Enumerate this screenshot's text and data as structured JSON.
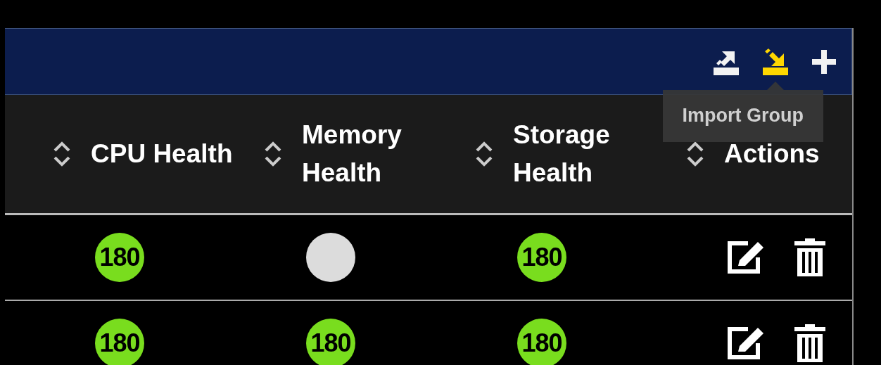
{
  "toolbar": {
    "actions": [
      {
        "kind": "export",
        "selected": false
      },
      {
        "kind": "import",
        "selected": true,
        "tooltip": "Import Group"
      },
      {
        "kind": "add",
        "selected": false
      }
    ]
  },
  "table": {
    "columns": [
      {
        "sortable": true
      },
      {
        "label": "CPU Health",
        "sortable": true
      },
      {
        "label": "Memory Health",
        "sortable": true
      },
      {
        "label": "Storage Health",
        "sortable": true
      },
      {
        "label": "Actions",
        "sortable": false
      }
    ],
    "rows": [
      {
        "cells": [
          {
            "kind": "blank"
          },
          {
            "kind": "value",
            "text": "180"
          },
          {
            "kind": "empty"
          },
          {
            "kind": "value",
            "text": "180"
          },
          {
            "kind": "actions"
          }
        ]
      },
      {
        "cells": [
          {
            "kind": "blank"
          },
          {
            "kind": "value",
            "text": "180"
          },
          {
            "kind": "value",
            "text": "180"
          },
          {
            "kind": "value",
            "text": "180"
          },
          {
            "kind": "actions"
          }
        ]
      }
    ]
  }
}
